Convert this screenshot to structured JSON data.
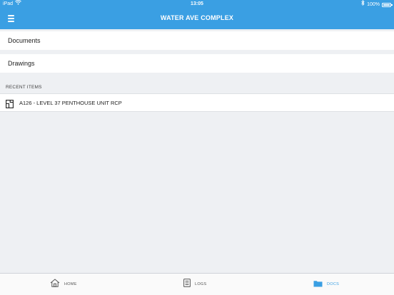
{
  "status_bar": {
    "device": "iPad",
    "time": "13:05",
    "battery": "100%"
  },
  "header": {
    "title": "WATER AVE COMPLEX"
  },
  "menu": {
    "items": [
      {
        "label": "Documents"
      },
      {
        "label": "Drawings"
      }
    ]
  },
  "recent": {
    "header": "RECENT ITEMS",
    "items": [
      {
        "label": "A126 - LEVEL 37 PENTHOUSE UNIT RCP",
        "icon": "floorplan-icon"
      }
    ]
  },
  "tabs": [
    {
      "label": "HOME",
      "icon": "home-icon",
      "active": false
    },
    {
      "label": "LOGS",
      "icon": "logs-icon",
      "active": false
    },
    {
      "label": "DOCS",
      "icon": "folder-icon",
      "active": true
    }
  ],
  "colors": {
    "accent": "#3a9fe3",
    "background": "#eef0f3"
  }
}
